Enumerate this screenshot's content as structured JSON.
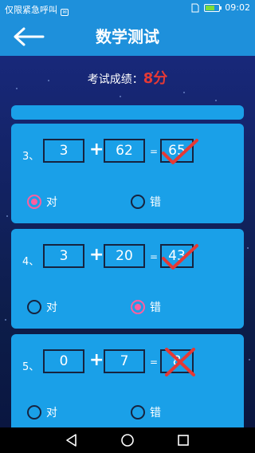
{
  "status_bar": {
    "carrier": "仅限紧急呼叫",
    "time": "09:02",
    "battery_level": 0.7
  },
  "app_bar": {
    "title": "数学测试",
    "back_icon": "arrow-left-icon"
  },
  "score": {
    "label": "考试成绩：",
    "value": "8分"
  },
  "questions": [
    {
      "index": "3、",
      "a": "3",
      "op": "+",
      "b": "62",
      "eq": "=",
      "answer": "65",
      "mark": "check",
      "options": [
        {
          "label": "对",
          "selected": true
        },
        {
          "label": "错",
          "selected": false
        }
      ]
    },
    {
      "index": "4、",
      "a": "3",
      "op": "+",
      "b": "20",
      "eq": "=",
      "answer": "43",
      "mark": "check",
      "options": [
        {
          "label": "对",
          "selected": false
        },
        {
          "label": "错",
          "selected": true
        }
      ]
    },
    {
      "index": "5、",
      "a": "0",
      "op": "+",
      "b": "7",
      "eq": "=",
      "answer": "8",
      "mark": "cross",
      "options": [
        {
          "label": "对",
          "selected": false
        },
        {
          "label": "错",
          "selected": false
        }
      ]
    }
  ],
  "colors": {
    "accent": "#1e90db",
    "card": "#1aa0e8",
    "mark_red": "#e53935",
    "radio_selected": "#ff5fa0"
  },
  "nav": {
    "back": "nav-back-icon",
    "home": "nav-home-icon",
    "recents": "nav-recents-icon"
  }
}
